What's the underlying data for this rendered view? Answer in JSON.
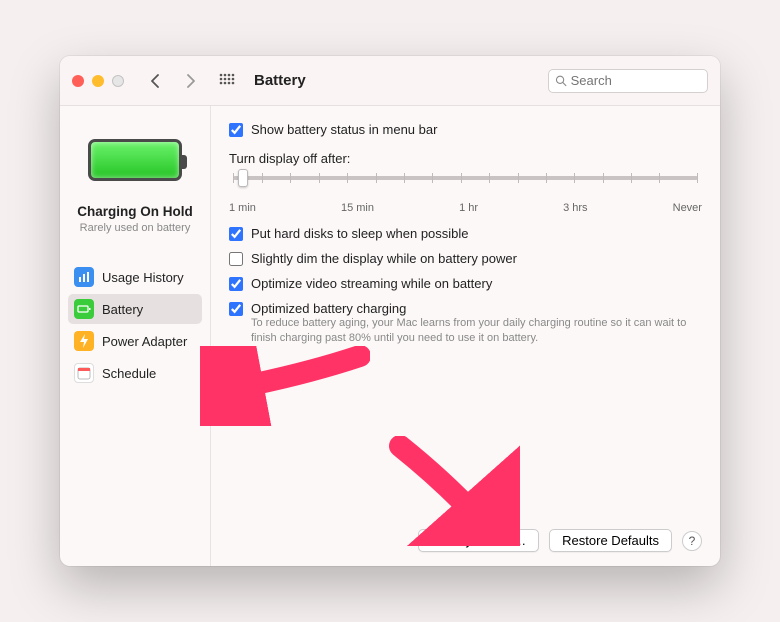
{
  "titlebar": {
    "title": "Battery",
    "search_placeholder": "Search"
  },
  "sidebar": {
    "status_title": "Charging On Hold",
    "status_sub": "Rarely used on battery",
    "items": [
      {
        "label": "Usage History"
      },
      {
        "label": "Battery"
      },
      {
        "label": "Power Adapter"
      },
      {
        "label": "Schedule"
      }
    ]
  },
  "main": {
    "show_status_label": "Show battery status in menu bar",
    "show_status_checked": true,
    "slider_label": "Turn display off after:",
    "slider_ticks": [
      "1 min",
      "15 min",
      "1 hr",
      "3 hrs",
      "Never"
    ],
    "hard_disks_label": "Put hard disks to sleep when possible",
    "hard_disks_checked": true,
    "dim_label": "Slightly dim the display while on battery power",
    "dim_checked": false,
    "optimize_video_label": "Optimize video streaming while on battery",
    "optimize_video_checked": true,
    "optimized_charging_label": "Optimized battery charging",
    "optimized_charging_checked": true,
    "optimized_charging_desc": "To reduce battery aging, your Mac learns from your daily charging routine so it can wait to finish charging past 80% until you need to use it on battery.",
    "battery_health_button": "Battery Health…",
    "restore_defaults_button": "Restore Defaults",
    "help_button": "?"
  }
}
